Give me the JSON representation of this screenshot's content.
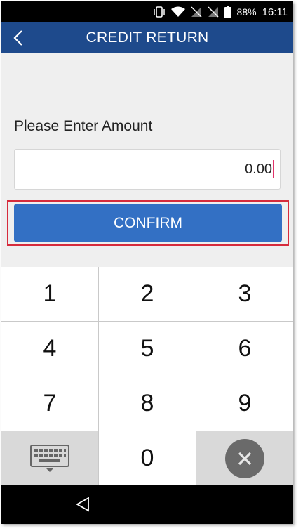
{
  "status_bar": {
    "battery_percent": "88%",
    "time": "16:11",
    "icons": [
      "vibrate-icon",
      "wifi-icon",
      "no-sim-icon",
      "no-sim-icon",
      "battery-icon"
    ]
  },
  "app_bar": {
    "title": "CREDIT RETURN",
    "back_icon": "chevron-left-icon"
  },
  "form": {
    "prompt": "Please Enter Amount",
    "amount_value": "0.00",
    "confirm_label": "CONFIRM"
  },
  "keypad": {
    "keys": [
      "1",
      "2",
      "3",
      "4",
      "5",
      "6",
      "7",
      "8",
      "9",
      "0"
    ],
    "keyboard_icon": "keyboard-icon",
    "clear_icon": "clear-icon"
  },
  "colors": {
    "app_bar": "#1e4a8c",
    "confirm_button": "#3370c4",
    "highlight_border": "#d62b3c",
    "caret": "#e0336a"
  }
}
